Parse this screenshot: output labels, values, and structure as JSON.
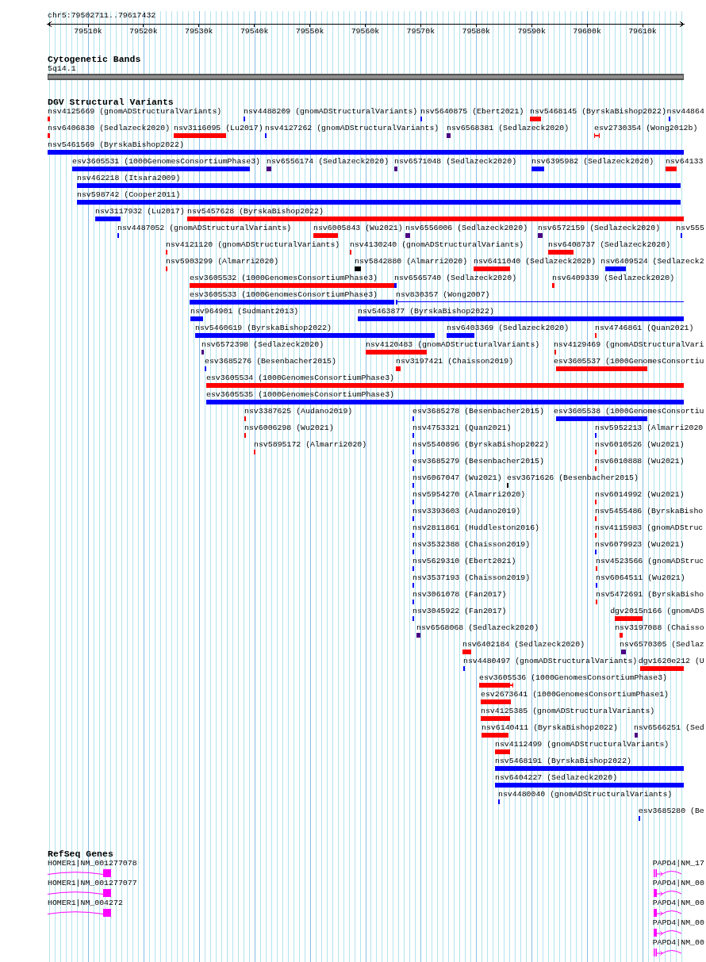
{
  "ruler": {
    "region": "chr5:79502711..79617432",
    "ticks": [
      "79510k",
      "79520k",
      "79530k",
      "79540k",
      "79550k",
      "79560k",
      "79570k",
      "79580k",
      "79590k",
      "79600k",
      "79610k"
    ]
  },
  "cytogenetic_bands": {
    "title": "Cytogenetic Bands",
    "band_label": "5q14.1"
  },
  "dgv_structural_variants": {
    "title": "DGV Structural Variants",
    "rows": [
      [
        {
          "label": "nsv4125669 (gnomADStructuralVariants)",
          "color": "#ff0000",
          "kind": "bar"
        },
        {
          "label": "nsv4488209 (gnomADStructuralVariants)",
          "color": "#0000ff",
          "kind": "bar"
        },
        {
          "label": "nsv5640875 (Ebert2021)",
          "color": "#0000ff",
          "kind": "bar"
        },
        {
          "label": "nsv5468145 (ByrskaBishop2022)",
          "color": "#ff0000",
          "kind": "bar"
        },
        {
          "label": "nsv44864",
          "color": "#0000ff",
          "kind": "bar"
        }
      ],
      [
        {
          "label": "nsv6406830 (Sedlazeck2020)",
          "color": "#ff0000",
          "kind": "bar"
        },
        {
          "label": "nsv3116095 (Lu2017)",
          "color": "#ff0000",
          "kind": "bar"
        },
        {
          "label": "nsv4127262 (gnomADStructuralVariants)",
          "color": "#0000ff",
          "kind": "bar"
        },
        {
          "label": "nsv6568381 (Sedlazeck2020)",
          "color": "#4b0082",
          "kind": "bar"
        },
        {
          "label": "esv2730354 (Wong2012b)",
          "color": "#ff0000",
          "kind": "capped"
        }
      ],
      [
        {
          "label": "nsv5461569 (ByrskaBishop2022)",
          "color": "#0000ff",
          "kind": "bar"
        }
      ],
      [
        {
          "label": "esv3605531 (1000GenomesConsortiumPhase3)",
          "color": "#0000ff",
          "kind": "bar"
        },
        {
          "label": "nsv6556174 (Sedlazeck2020)",
          "color": "#4b0082",
          "kind": "bar"
        },
        {
          "label": "nsv6571048 (Sedlazeck2020)",
          "color": "#4b0082",
          "kind": "bar"
        },
        {
          "label": "nsv6395982 (Sedlazeck2020)",
          "color": "#0000ff",
          "kind": "bar"
        },
        {
          "label": "nsv64133",
          "color": "#ff0000",
          "kind": "bar"
        }
      ],
      [
        {
          "label": "nsv462218 (Itsara2009)",
          "color": "#0000ff",
          "kind": "bar"
        }
      ],
      [
        {
          "label": "nsv598742 (Cooper2011)",
          "color": "#0000ff",
          "kind": "bar"
        }
      ],
      [
        {
          "label": "nsv3117932 (Lu2017)",
          "color": "#0000ff",
          "kind": "bar"
        },
        {
          "label": "nsv5457628 (ByrskaBishop2022)",
          "color": "#ff0000",
          "kind": "bar"
        }
      ],
      [
        {
          "label": "nsv4487052 (gnomADStructuralVariants)",
          "color": "#0000ff",
          "kind": "bar"
        },
        {
          "label": "nsv6005843 (Wu2021)",
          "color": "#ff0000",
          "kind": "bar"
        },
        {
          "label": "nsv6556006 (Sedlazeck2020)",
          "color": "#4b0082",
          "kind": "bar"
        },
        {
          "label": "nsv6572159 (Sedlazeck2020)",
          "color": "#4b0082",
          "kind": "bar"
        },
        {
          "label": "nsv555",
          "color": "#0000ff",
          "kind": "bar"
        }
      ],
      [
        {
          "label": "nsv4121120 (gnomADStructuralVariants)",
          "color": "#ff0000",
          "kind": "bar"
        },
        {
          "label": "nsv4130240 (gnomADStructuralVariants)",
          "color": "#ff0000",
          "kind": "bar"
        },
        {
          "label": "nsv6408737 (Sedlazeck2020)",
          "color": "#ff0000",
          "kind": "bar"
        }
      ],
      [
        {
          "label": "nsv5903299 (Almarri2020)",
          "color": "#ff0000",
          "kind": "bar"
        },
        {
          "label": "nsv5842880 (Almarri2020)",
          "color": "#000000",
          "kind": "bar"
        },
        {
          "label": "nsv6411040 (Sedlazeck2020)",
          "color": "#ff0000",
          "kind": "bar"
        },
        {
          "label": "nsv6409524 (Sedlazeck2",
          "color": "#0000ff",
          "kind": "bar"
        }
      ],
      [
        {
          "label": "esv3605532 (1000GenomesConsortiumPhase3)",
          "color": "#ff0000",
          "kind": "bar"
        },
        {
          "label": "nsv6565740 (Sedlazeck2020)",
          "color": "#0000ff",
          "kind": "bar"
        },
        {
          "label": "nsv6409339 (Sedlazeck2020)",
          "color": "#ff0000",
          "kind": "bar"
        }
      ],
      [
        {
          "label": "esv3605533 (1000GenomesConsortiumPhase3)",
          "color": "#0000ff",
          "kind": "bar"
        },
        {
          "label": "nsv830357 (Wong2007)",
          "color": "#0000ff",
          "kind": "thin"
        }
      ],
      [
        {
          "label": "nsv964901 (Sudmant2013)",
          "color": "#0000ff",
          "kind": "bar"
        },
        {
          "label": "nsv5463877 (ByrskaBishop2022)",
          "color": "#0000ff",
          "kind": "bar"
        }
      ],
      [
        {
          "label": "nsv5460619 (ByrskaBishop2022)",
          "color": "#0000ff",
          "kind": "bar"
        },
        {
          "label": "nsv6403369 (Sedlazeck2020)",
          "color": "#0000ff",
          "kind": "bar"
        },
        {
          "label": "nsv4746861 (Quan2021)",
          "color": "#ff0000",
          "kind": "bar"
        }
      ],
      [
        {
          "label": "nsv6572398 (Sedlazeck2020)",
          "color": "#4b0082",
          "kind": "bar"
        },
        {
          "label": "nsv4120483 (gnomADStructuralVariants)",
          "color": "#ff0000",
          "kind": "bar"
        },
        {
          "label": "nsv4129469 (gnomADStructuralVari",
          "color": "#ff0000",
          "kind": "bar"
        }
      ],
      [
        {
          "label": "esv3685276 (Besenbacher2015)",
          "color": "#0000ff",
          "kind": "bar"
        },
        {
          "label": "nsv3197421 (Chaisson2019)",
          "color": "#ff0000",
          "kind": "bar"
        },
        {
          "label": "esv3605537 (1000GenomesConsortiu",
          "color": "#ff0000",
          "kind": "bar"
        }
      ],
      [
        {
          "label": "esv3605534 (1000GenomesConsortiumPhase3)",
          "color": "#ff0000",
          "kind": "bar"
        }
      ],
      [
        {
          "label": "esv3605535 (1000GenomesConsortiumPhase3)",
          "color": "#0000ff",
          "kind": "bar"
        }
      ],
      [
        {
          "label": "nsv3387625 (Audano2019)",
          "color": "#ff0000",
          "kind": "bar"
        },
        {
          "label": "esv3685278 (Besenbacher2015)",
          "color": "#0000ff",
          "kind": "bar"
        },
        {
          "label": "esv3605538 (1000GenomesConsortiu",
          "color": "#0000ff",
          "kind": "bar"
        }
      ],
      [
        {
          "label": "nsv6006298 (Wu2021)",
          "color": "#ff0000",
          "kind": "bar"
        },
        {
          "label": "nsv4753321 (Quan2021)",
          "color": "#0000ff",
          "kind": "bar"
        },
        {
          "label": "nsv5952213 (Almarri2020",
          "color": "#0000ff",
          "kind": "bar"
        }
      ],
      [
        {
          "label": "nsv5895172 (Almarri2020)",
          "color": "#ff0000",
          "kind": "bar"
        },
        {
          "label": "nsv5540896 (ByrskaBishop2022)",
          "color": "#0000ff",
          "kind": "bar"
        },
        {
          "label": "nsv6010526 (Wu2021)",
          "color": "#ff0000",
          "kind": "bar"
        }
      ],
      [
        {
          "label": "esv3685279 (Besenbacher2015)",
          "color": "#0000ff",
          "kind": "bar"
        },
        {
          "label": "nsv6010888 (Wu2021)",
          "color": "#ff0000",
          "kind": "bar"
        }
      ],
      [
        {
          "label": "nsv6067047 (Wu2021)",
          "color": "#0000ff",
          "kind": "bar"
        },
        {
          "label": "esv3671626 (Besenbacher2015)",
          "color": "#000000",
          "kind": "bar"
        }
      ],
      [
        {
          "label": "nsv5954270 (Almarri2020)",
          "color": "#0000ff",
          "kind": "bar"
        },
        {
          "label": "nsv6014992 (Wu2021)",
          "color": "#ff0000",
          "kind": "bar"
        }
      ],
      [
        {
          "label": "nsv3393603 (Audano2019)",
          "color": "#0000ff",
          "kind": "bar"
        },
        {
          "label": "nsv5455486 (ByrskaBisho",
          "color": "#ff0000",
          "kind": "bar"
        }
      ],
      [
        {
          "label": "nsv2811861 (Huddleston2016)",
          "color": "#0000ff",
          "kind": "bar"
        },
        {
          "label": "nsv4115983 (gnomADStruc",
          "color": "#ff0000",
          "kind": "bar"
        }
      ],
      [
        {
          "label": "nsv3532388 (Chaisson2019)",
          "color": "#0000ff",
          "kind": "bar"
        },
        {
          "label": "nsv6079923 (Wu2021)",
          "color": "#0000ff",
          "kind": "bar"
        }
      ],
      [
        {
          "label": "nsv5629310 (Ebert2021)",
          "color": "#0000ff",
          "kind": "bar"
        },
        {
          "label": "nsv4523566 (gnomADStruc",
          "color": "#ff0000",
          "kind": "bar"
        }
      ],
      [
        {
          "label": "nsv3537193 (Chaisson2019)",
          "color": "#0000ff",
          "kind": "bar"
        },
        {
          "label": "nsv6064511 (Wu2021)",
          "color": "#0000ff",
          "kind": "bar"
        }
      ],
      [
        {
          "label": "nsv3061078 (Fan2017)",
          "color": "#0000ff",
          "kind": "bar"
        },
        {
          "label": "nsv5472691 (ByrskaBisho",
          "color": "#ff0000",
          "kind": "bar"
        }
      ],
      [
        {
          "label": "nsv3045922 (Fan2017)",
          "color": "#0000ff",
          "kind": "bar"
        },
        {
          "label": "dgv2015n166 (gnomADS",
          "color": "#ff0000",
          "kind": "bar"
        }
      ],
      [
        {
          "label": "nsv6568068 (Sedlazeck2020)",
          "color": "#4b0082",
          "kind": "bar"
        },
        {
          "label": "nsv3197088 (Chaisso",
          "color": "#ff0000",
          "kind": "bar"
        }
      ],
      [
        {
          "label": "nsv6402184 (Sedlazeck2020)",
          "color": "#ff0000",
          "kind": "bar"
        },
        {
          "label": "nsv6570305 (Sedlaz",
          "color": "#4b0082",
          "kind": "bar"
        }
      ],
      [
        {
          "label": "nsv4480497 (gnomADStructuralVariants)",
          "color": "#0000ff",
          "kind": "bar"
        },
        {
          "label": "dgv1620e212 (U",
          "color": "#ff0000",
          "kind": "bar"
        }
      ],
      [
        {
          "label": "esv3605536 (1000GenomesConsortiumPhase3)",
          "color": "#ff0000",
          "kind": "capped"
        }
      ],
      [
        {
          "label": "esv2673641 (1000GenomesConsortiumPhase1)",
          "color": "#ff0000",
          "kind": "bar"
        }
      ],
      [
        {
          "label": "nsv4125385 (gnomADStructuralVariants)",
          "color": "#ff0000",
          "kind": "bar"
        }
      ],
      [
        {
          "label": "nsv6140411 (ByrskaBishop2022)",
          "color": "#ff0000",
          "kind": "bar"
        },
        {
          "label": "nsv6566251 (Sed",
          "color": "#4b0082",
          "kind": "bar"
        }
      ],
      [
        {
          "label": "nsv4112499 (gnomADStructuralVariants)",
          "color": "#ff0000",
          "kind": "bar"
        }
      ],
      [
        {
          "label": "nsv5468191 (ByrskaBishop2022)",
          "color": "#0000ff",
          "kind": "bar"
        }
      ],
      [
        {
          "label": "nsv6404227 (Sedlazeck2020)",
          "color": "#0000ff",
          "kind": "bar"
        }
      ],
      [
        {
          "label": "nsv4480040 (gnomADStructuralVariants)",
          "color": "#0000ff",
          "kind": "bar"
        }
      ],
      [
        {
          "label": "esv3685280 (Be",
          "color": "#0000ff",
          "kind": "bar"
        }
      ]
    ]
  },
  "refseq_genes": {
    "title": "RefSeq Genes",
    "rows": [
      [
        {
          "label": "HOMER1|NM_001277078",
          "kind": "right"
        },
        {
          "label": "PAPD4|NM_17",
          "kind": "split"
        }
      ],
      [
        {
          "label": "HOMER1|NM_001277077",
          "kind": "right"
        },
        {
          "label": "PAPD4|NM_00",
          "kind": "left"
        }
      ],
      [
        {
          "label": "HOMER1|NM_004272",
          "kind": "right"
        },
        {
          "label": "PAPD4|NM_00",
          "kind": "left"
        }
      ],
      [
        {
          "label": "PAPD4|NM_00",
          "kind": "left"
        }
      ],
      [
        {
          "label": "PAPD4|NM_00",
          "kind": "split"
        }
      ]
    ]
  }
}
